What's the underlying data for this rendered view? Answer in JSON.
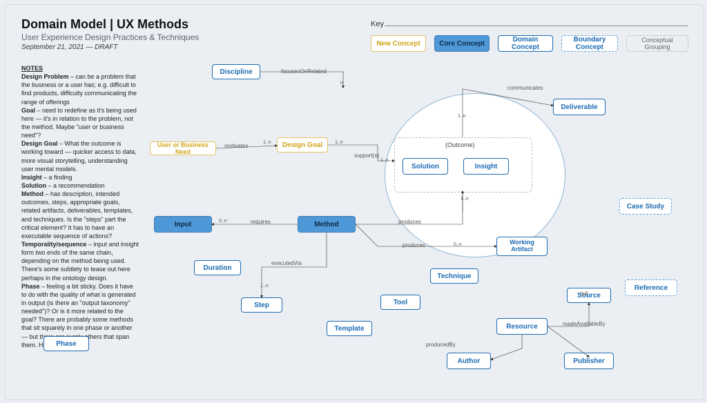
{
  "header": {
    "title": "Domain Model | UX Methods",
    "subtitle": "User Experience Design Practices & Techniques",
    "date": "September 21, 2021 — DRAFT"
  },
  "key": {
    "label": "Key",
    "items": {
      "new": "New Concept",
      "core": "Core Concept",
      "domain": "Domain Concept",
      "boundary": "Boundary Concept",
      "group": "Conceptual Grouping"
    }
  },
  "notes_heading": "NOTES",
  "notes": [
    {
      "t": "Design Problem",
      "b": " – can be a problem that the business or a user has; e.g. difficult to find products, difficulty communicating the range of offerings"
    },
    {
      "t": "Goal",
      "b": " – need to redefine as it's being used here — it's in relation to the problem, not the method. Maybe \"user or business need\"?"
    },
    {
      "t": "Design Goal",
      "b": " – What the outcome is working toward — quicker access to data, more visual storytelling, understanding user mental models."
    },
    {
      "t": "Insight",
      "b": " – a finding"
    },
    {
      "t": "Solution",
      "b": " – a recommendation"
    },
    {
      "t": "Method",
      "b": " – has description, intended outcomes, steps, appropriate goals, related artifacts, deliverables, templates, and techniques. Is the \"steps\" part the critical element? It has to have an executable sequence of actions?"
    },
    {
      "t": "Temporality/sequence",
      "b": " – input and insight form two ends of the same chain, depending on the method being used. There's some subtlety to tease out here perhaps in the ontology design."
    },
    {
      "t": "Phase",
      "b": " – feeling a bit sticky. Does it have to do with the quality of what is generated in output (is there an \"output taxonomy\" needed\")? Or is it more related to the goal? There are probably some methods that sit squarely in one phase or another — but there are surely others that span them. How to sort this?"
    }
  ],
  "nodes": {
    "discipline": "Discipline",
    "design_goal": "Design Goal",
    "ubn": "User or Business Need",
    "input": "Input",
    "method": "Method",
    "duration": "Duration",
    "step": "Step",
    "phase": "Phase",
    "template": "Template",
    "tool": "Tool",
    "technique": "Technique",
    "outcome": "(Outcome)",
    "solution": "Solution",
    "insight": "Insight",
    "deliverable": "Deliverable",
    "case_study": "Case Study",
    "reference": "Reference",
    "working_artifact": "Working Artifact",
    "resource": "Resource",
    "source": "Source",
    "author": "Author",
    "publisher": "Publisher"
  },
  "edges": {
    "motivates": "motivates",
    "focuses": "focusesOnRelated",
    "requires": "requires",
    "supports": "support(s)",
    "communicates": "communicates",
    "produces": "produces",
    "executed": "executedVia",
    "isa": "isA",
    "madeAvailableBy": "madeAvailableBy",
    "producedBy": "producedBy"
  },
  "card": {
    "n": "n",
    "zn": "0..n",
    "on": "1..n"
  }
}
